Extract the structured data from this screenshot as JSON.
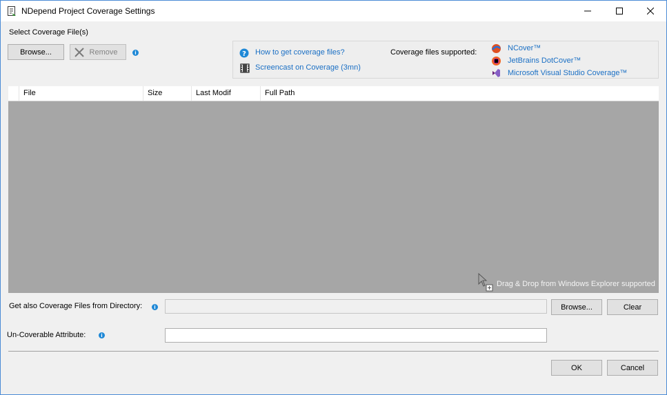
{
  "window": {
    "title": "NDepend Project Coverage Settings"
  },
  "coverage_files": {
    "section_label": "Select Coverage File(s)",
    "browse_label": "Browse...",
    "remove_label": "Remove"
  },
  "help_panel": {
    "how_to_link": "How to get coverage files?",
    "screencast_link": "Screencast on Coverage (3mn)",
    "supported_label": "Coverage files supported:",
    "tools": [
      "NCover™",
      "JetBrains DotCover™",
      "Microsoft Visual Studio Coverage™"
    ]
  },
  "grid": {
    "columns": [
      "File",
      "Size",
      "Last Modif",
      "Full Path"
    ],
    "drag_drop_hint": "Drag & Drop from Windows Explorer supported"
  },
  "directory": {
    "label": "Get also Coverage Files from Directory:",
    "value": "",
    "browse_label": "Browse...",
    "clear_label": "Clear"
  },
  "uncoverable": {
    "label": "Un-Coverable Attribute:",
    "value": ""
  },
  "footer": {
    "ok_label": "OK",
    "cancel_label": "Cancel"
  },
  "colors": {
    "link": "#1a6fc4",
    "grid_background": "#a6a6a6",
    "info_icon": "#1e88d6"
  },
  "icons": [
    "document-icon",
    "minimize-icon",
    "maximize-icon",
    "close-icon",
    "remove-x-icon",
    "info-icon",
    "help-question-icon",
    "film-icon",
    "ncover-icon",
    "dotcover-icon",
    "visual-studio-icon",
    "drag-cursor-icon"
  ]
}
